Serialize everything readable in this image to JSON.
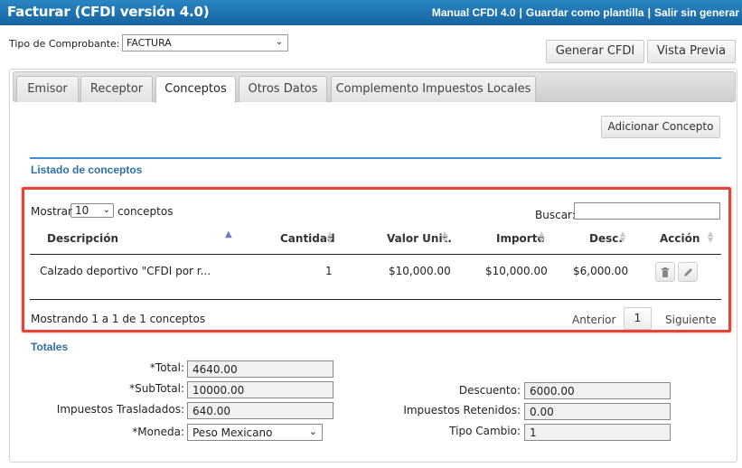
{
  "header": {
    "title": "Facturar (CFDI versión 4.0)",
    "links": [
      "Manual CFDI 4.0",
      "Guardar como plantilla",
      "Salir sin generar"
    ],
    "separator": "|"
  },
  "tipo_comprobante": {
    "label": "Tipo de Comprobante:",
    "value": "FACTURA"
  },
  "actions": {
    "generar": "Generar CFDI",
    "vista_previa": "Vista Previa"
  },
  "tabs": [
    "Emisor",
    "Receptor",
    "Conceptos",
    "Otros Datos",
    "Complemento Impuestos Locales"
  ],
  "active_tab": "Conceptos",
  "adicionar_concepto": "Adicionar Concepto",
  "listado": {
    "title": "Listado de conceptos",
    "mostrar_label": "Mostrar",
    "page_length": "10",
    "conceptos_label": "conceptos",
    "buscar_label": "Buscar:",
    "buscar_value": "",
    "columns": [
      "Descripción",
      "Cantidad",
      "Valor Unit.",
      "Importe",
      "Desc.",
      "Acción"
    ],
    "rows": [
      {
        "descripcion": "Calzado deportivo \"CFDI por r...",
        "cantidad": "1",
        "valor_unit": "$10,000.00",
        "importe": "$10,000.00",
        "desc": "$6,000.00"
      }
    ],
    "info": "Mostrando 1 a 1 de 1 conceptos",
    "pagination": {
      "prev": "Anterior",
      "current": "1",
      "next": "Siguiente"
    }
  },
  "totales": {
    "title": "Totales",
    "total_label": "*Total:",
    "total": "4640.00",
    "subtotal_label": "*SubTotal:",
    "subtotal": "10000.00",
    "impuestos_trasladados_label": "Impuestos Trasladados:",
    "impuestos_trasladados": "640.00",
    "moneda_label": "*Moneda:",
    "moneda": "Peso Mexicano",
    "descuento_label": "Descuento:",
    "descuento": "6000.00",
    "impuestos_retenidos_label": "Impuestos Retenidos:",
    "impuestos_retenidos": "0.00",
    "tipo_cambio_label": "Tipo Cambio:",
    "tipo_cambio": "1"
  },
  "colors": {
    "header_blue": "#1f75b3",
    "accent_blue": "#2e6fa6",
    "highlight_red": "#e0473c"
  }
}
